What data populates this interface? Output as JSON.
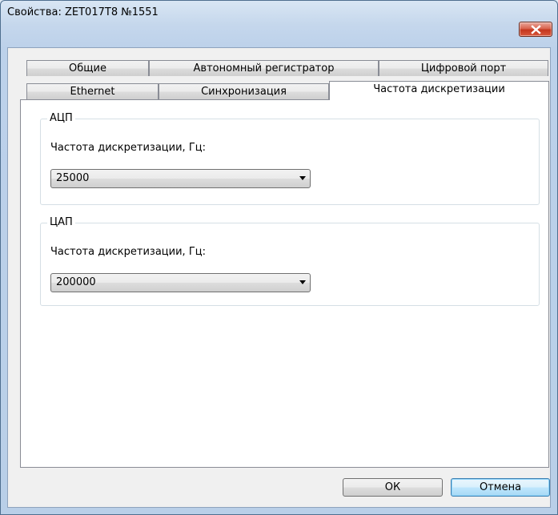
{
  "window": {
    "title": "Свойства: ZET017T8 №1551"
  },
  "tabs": {
    "row_back": [
      {
        "label": "Общие"
      },
      {
        "label": "Автономный регистратор"
      },
      {
        "label": "Цифровой порт"
      }
    ],
    "row_front": [
      {
        "label": "Ethernet"
      },
      {
        "label": "Синхронизация"
      },
      {
        "label": "Частота дискретизации"
      }
    ],
    "active": "Частота дискретизации"
  },
  "adc_group": {
    "caption": "АЦП",
    "label": "Частота дискретизации, Гц:",
    "value": "25000"
  },
  "dac_group": {
    "caption": "ЦАП",
    "label": "Частота дискретизации, Гц:",
    "value": "200000"
  },
  "buttons": {
    "ok": "ОК",
    "cancel": "Отмена"
  },
  "colors": {
    "frame": "#b9cfe8",
    "close_button": "#c4361d",
    "focus_button": "#3c7fb1"
  }
}
